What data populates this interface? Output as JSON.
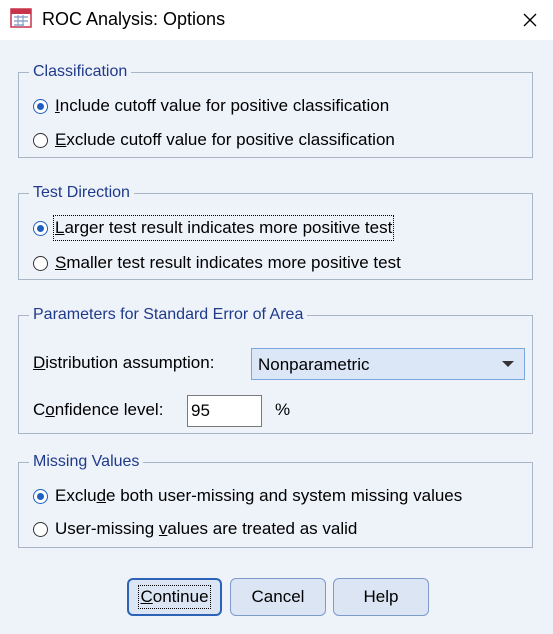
{
  "window": {
    "title": "ROC Analysis: Options",
    "app_icon": "spss-roc-icon",
    "close_icon": "close-icon"
  },
  "classification": {
    "title": "Classification",
    "options": [
      {
        "label": "Include cutoff value for positive classification",
        "underline": "I",
        "rest": "nclude cutoff value for positive classification",
        "checked": true
      },
      {
        "label": "Exclude cutoff value for positive classification",
        "underline": "E",
        "rest": "xclude cutoff value for positive classification",
        "checked": false
      }
    ]
  },
  "test_direction": {
    "title": "Test Direction",
    "options": [
      {
        "label": "Larger test result indicates more positive test",
        "underline": "L",
        "rest": "arger test result indicates more positive test",
        "checked": true
      },
      {
        "label": "Smaller test result indicates more positive test",
        "underline": "S",
        "rest": "maller test result indicates more positive test",
        "checked": false
      }
    ]
  },
  "parameters": {
    "title": "Parameters for Standard Error of Area",
    "distribution_label": "Distribution assumption:",
    "distribution_underline": "D",
    "distribution_rest": "istribution assumption:",
    "distribution_value": "Nonparametric",
    "confidence_label": "Confidence level:",
    "confidence_pre": "C",
    "confidence_underline": "o",
    "confidence_rest": "nfidence level:",
    "confidence_value": "95",
    "percent": "%"
  },
  "missing_values": {
    "title": "Missing Values",
    "options": [
      {
        "label": "Exclude both user-missing and system missing values",
        "pre": "Exclu",
        "underline": "d",
        "rest": "e both user-missing and system missing values",
        "checked": true
      },
      {
        "label": "User-missing values are treated as valid",
        "pre": "User-missing ",
        "underline": "v",
        "rest": "alues are treated as valid",
        "checked": false
      }
    ]
  },
  "buttons": {
    "continue_underline": "C",
    "continue_rest": "ontinue",
    "cancel": "Cancel",
    "help": "Help"
  }
}
